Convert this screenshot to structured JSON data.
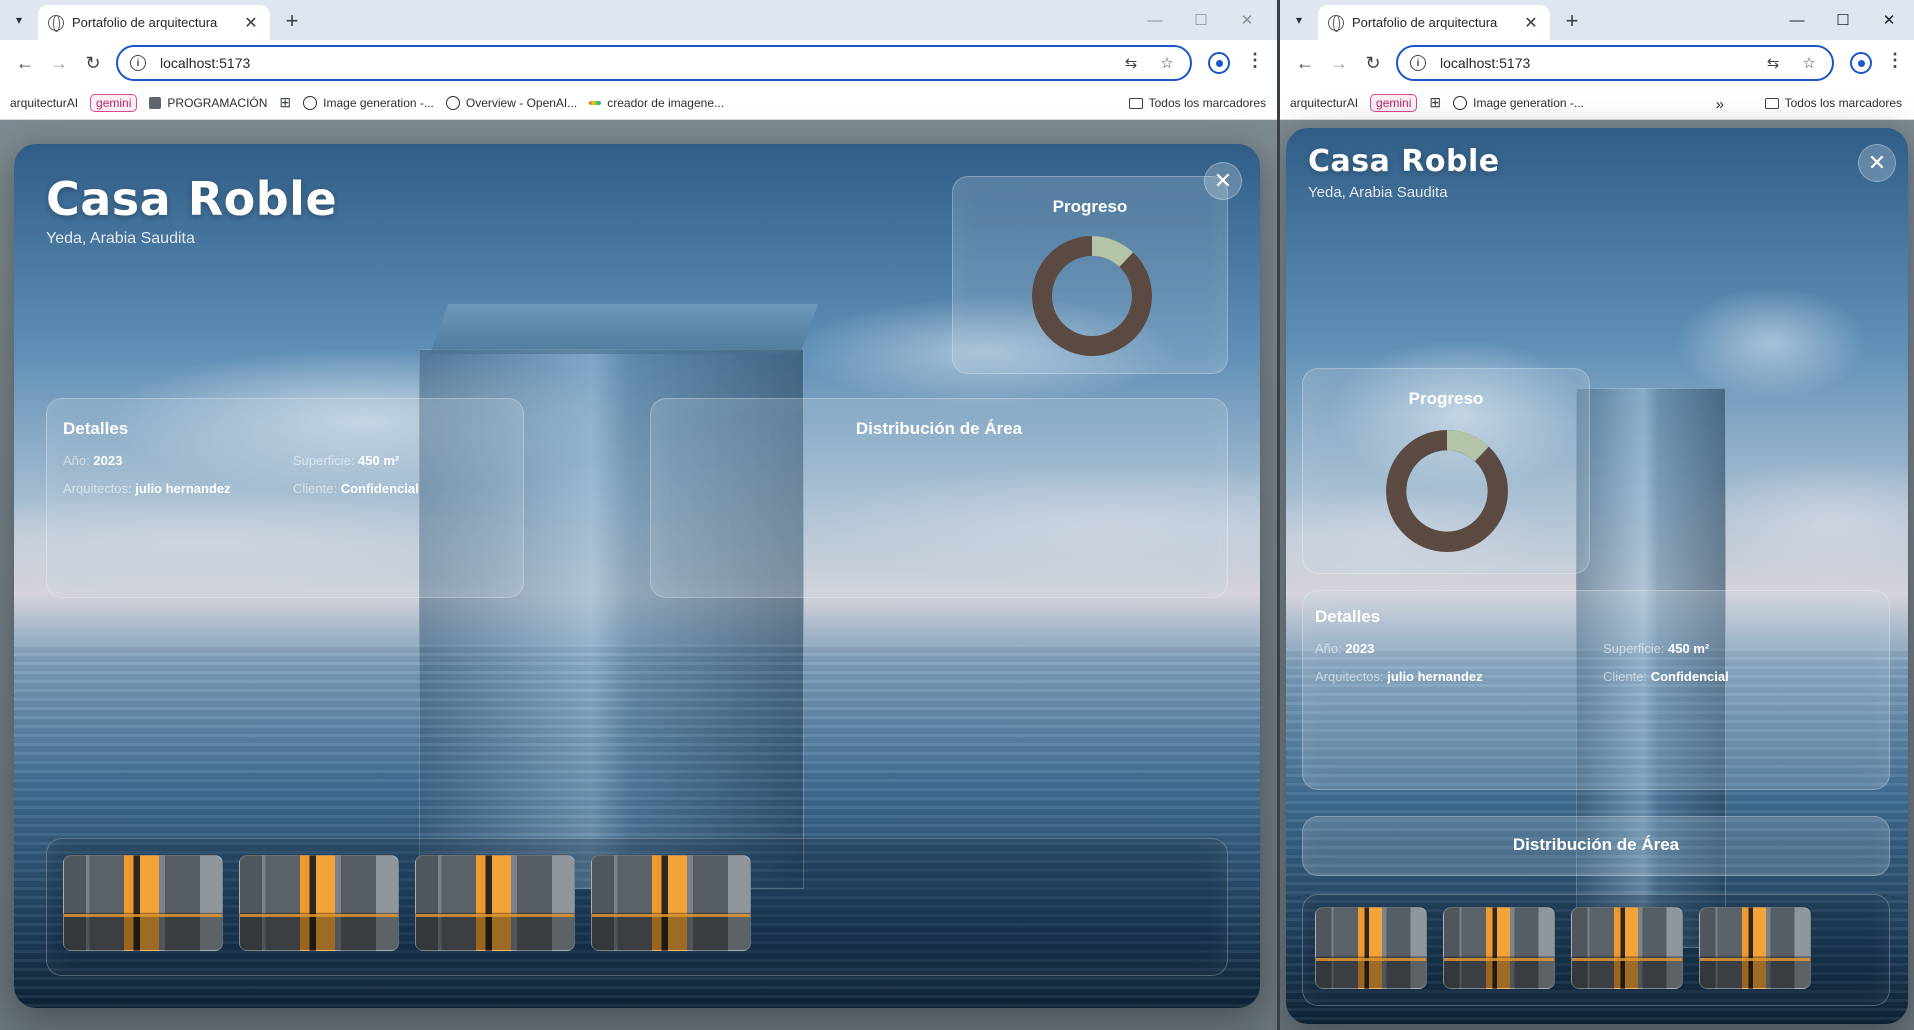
{
  "browser": {
    "tab_title": "Portafolio de arquitectura",
    "url": "localhost:5173",
    "bookmarks_left": [
      "arquitecturAI",
      "gemini",
      "PROGRAMACIÓN",
      "Image generation -...",
      "Overview - OpenAI...",
      "creador de imagene..."
    ],
    "bookmarks_right_short": [
      "arquitecturAI",
      "gemini",
      "Image generation -..."
    ],
    "all_bookmarks": "Todos los marcadores",
    "overflow": "»"
  },
  "project": {
    "title": "Casa Roble",
    "location": "Yeda, Arabia Saudita",
    "progress_title": "Progreso",
    "progress_fraction": 0.12,
    "details_title": "Detalles",
    "year_label": "Año:",
    "year_value": "2023",
    "area_label": "Superficie:",
    "area_value": "450 m²",
    "architects_label": "Arquitectos:",
    "architects_value": "julio hernandez",
    "client_label": "Cliente:",
    "client_value": "Confidencial",
    "area_dist_title": "Distribución de Área"
  },
  "colors": {
    "donut_main": "#5b4a42",
    "donut_accent": "#b3c4a8",
    "accent_blue": "#1a56c9"
  },
  "icons": {
    "close": "close-icon",
    "back": "arrow-left-icon",
    "forward": "arrow-right-icon",
    "reload": "reload-icon"
  }
}
